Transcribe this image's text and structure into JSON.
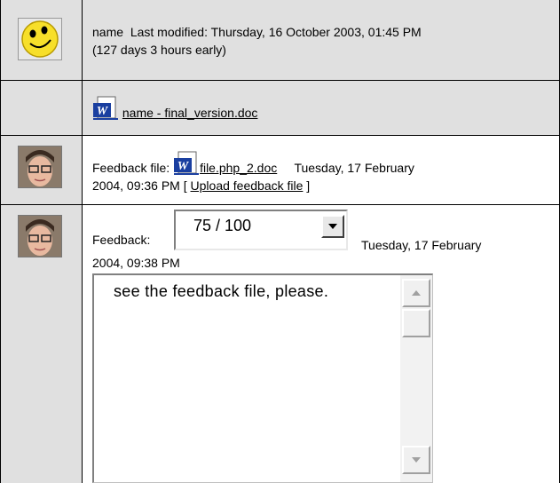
{
  "submission": {
    "name": "name",
    "modified_label": "Last modified: Thursday, 16 October 2003, 01:45 PM",
    "early_note": "(127 days 3 hours early)",
    "file_name": "name -  final_version.doc"
  },
  "feedback_file": {
    "label": "Feedback file:",
    "file_name": "file.php_2.doc",
    "date_part1": "Tuesday, 17 February",
    "date_part2": "2004, 09:36 PM [ ",
    "upload_link": "Upload feedback file",
    "bracket_close": " ]"
  },
  "feedback": {
    "label": "Feedback:",
    "grade_value": "75 / 100",
    "date_part1": "Tuesday, 17 February",
    "date_part2": "2004, 09:38 PM",
    "comment_text": "see the feedback file, please."
  },
  "icons": {
    "smiley": "smiley-face-icon",
    "avatar": "teacher-avatar",
    "word_doc": "word-document-icon"
  },
  "colors": {
    "left_column": "#e0e0e0",
    "header_row": "#e0e0e0"
  }
}
